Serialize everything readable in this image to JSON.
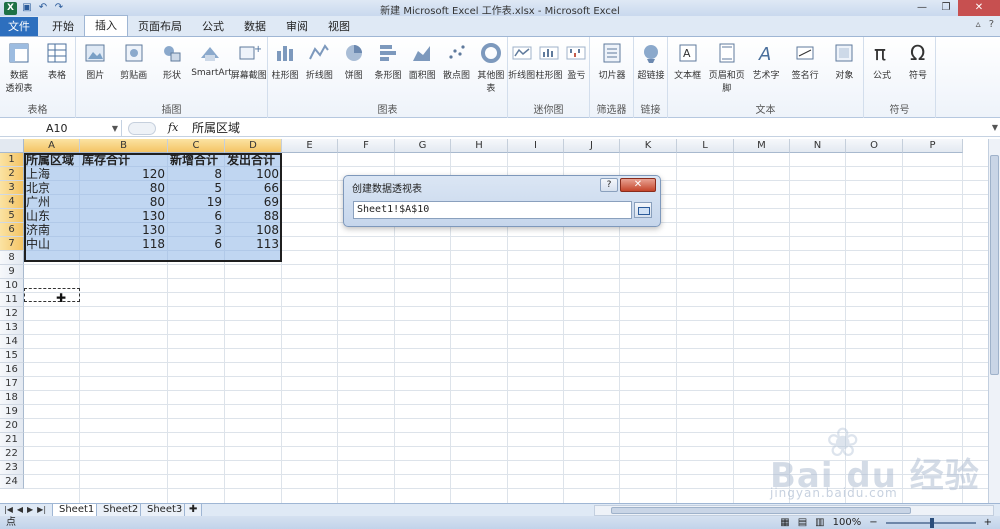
{
  "window": {
    "title": "新建 Microsoft Excel 工作表.xlsx - Microsoft Excel",
    "minimize": "—",
    "restore": "❐",
    "close": "✕"
  },
  "tabs": [
    {
      "label": "文件"
    },
    {
      "label": "开始"
    },
    {
      "label": "插入"
    },
    {
      "label": "页面布局"
    },
    {
      "label": "公式"
    },
    {
      "label": "数据"
    },
    {
      "label": "审阅"
    },
    {
      "label": "视图"
    }
  ],
  "active_tab": "插入",
  "ribbon": {
    "groups": [
      {
        "title": "表格",
        "buttons": [
          {
            "label": "数据",
            "sub": "透视表",
            "icon": "pivot-icon"
          },
          {
            "label": "表格",
            "icon": "table-icon"
          }
        ]
      },
      {
        "title": "插图",
        "buttons": [
          {
            "label": "图片",
            "icon": "picture-icon"
          },
          {
            "label": "剪贴画",
            "icon": "clipart-icon"
          },
          {
            "label": "形状",
            "icon": "shapes-icon"
          },
          {
            "label": "SmartArt",
            "icon": "smartart-icon"
          },
          {
            "label": "屏幕截图",
            "icon": "screenshot-icon"
          }
        ]
      },
      {
        "title": "图表",
        "buttons": [
          {
            "label": "柱形图",
            "icon": "column-chart-icon"
          },
          {
            "label": "折线图",
            "icon": "line-chart-icon"
          },
          {
            "label": "饼图",
            "icon": "pie-chart-icon"
          },
          {
            "label": "条形图",
            "icon": "bar-chart-icon"
          },
          {
            "label": "面积图",
            "icon": "area-chart-icon"
          },
          {
            "label": "散点图",
            "icon": "scatter-chart-icon"
          },
          {
            "label": "其他图表",
            "icon": "other-chart-icon"
          }
        ]
      },
      {
        "title": "迷你图",
        "buttons": [
          {
            "label": "折线图",
            "icon": "sparkline-line-icon"
          },
          {
            "label": "柱形图",
            "icon": "sparkline-column-icon"
          },
          {
            "label": "盈亏",
            "icon": "sparkline-winloss-icon"
          }
        ]
      },
      {
        "title": "筛选器",
        "buttons": [
          {
            "label": "切片器",
            "icon": "slicer-icon"
          }
        ]
      },
      {
        "title": "链接",
        "buttons": [
          {
            "label": "超链接",
            "icon": "hyperlink-icon"
          }
        ]
      },
      {
        "title": "文本",
        "buttons": [
          {
            "label": "文本框",
            "icon": "textbox-icon"
          },
          {
            "label": "页眉和页脚",
            "icon": "header-footer-icon"
          },
          {
            "label": "艺术字",
            "icon": "wordart-icon"
          },
          {
            "label": "签名行",
            "icon": "signature-icon"
          },
          {
            "label": "对象",
            "icon": "object-icon"
          }
        ]
      },
      {
        "title": "符号",
        "buttons": [
          {
            "label": "公式",
            "icon": "equation-icon"
          },
          {
            "label": "符号",
            "icon": "symbol-icon"
          }
        ]
      }
    ]
  },
  "formula_bar": {
    "name_box": "A10",
    "fx": "fx",
    "content": "所属区域"
  },
  "columns": [
    "A",
    "B",
    "C",
    "D",
    "E",
    "F",
    "G",
    "H",
    "I",
    "J",
    "K",
    "L",
    "M",
    "N",
    "O",
    "P"
  ],
  "rows": [
    "1",
    "2",
    "3",
    "4",
    "5",
    "6",
    "7",
    "8",
    "9",
    "10",
    "11",
    "12",
    "13",
    "14",
    "15",
    "16",
    "17",
    "18",
    "19",
    "20",
    "21",
    "22",
    "23",
    "24"
  ],
  "table": {
    "headers": [
      "所属区域",
      "库存合计",
      "新增合计",
      "发出合计"
    ],
    "rows": [
      [
        "上海",
        "120",
        "8",
        "100"
      ],
      [
        "北京",
        "80",
        "5",
        "66"
      ],
      [
        "广州",
        "80",
        "19",
        "69"
      ],
      [
        "山东",
        "130",
        "6",
        "88"
      ],
      [
        "济南",
        "130",
        "3",
        "108"
      ],
      [
        "中山",
        "118",
        "6",
        "113"
      ]
    ]
  },
  "dialog": {
    "title": "创建数据透视表",
    "help": "?",
    "close": "✕",
    "range_value": "Sheet1!$A$10"
  },
  "sheet_tabs": [
    {
      "label": "Sheet1"
    },
    {
      "label": "Sheet2"
    },
    {
      "label": "Sheet3"
    }
  ],
  "active_sheet": "Sheet1",
  "status": {
    "left": "点",
    "zoom": "100%"
  },
  "watermark": {
    "brand": "Bai du 经验",
    "url": "jingyan.baidu.com"
  },
  "colors": {
    "file_tab": "#2d6fbe",
    "selection": "#8cb4e6",
    "header_highlight": "#f4c465"
  }
}
